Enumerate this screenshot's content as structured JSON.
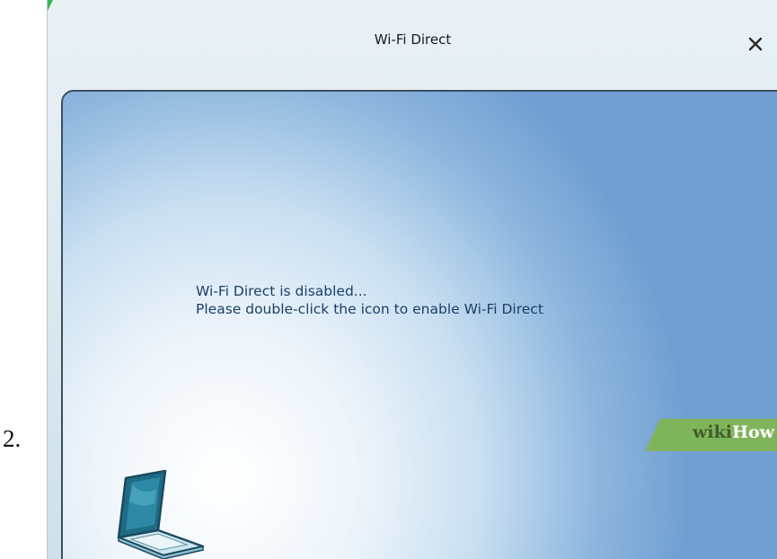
{
  "step": {
    "number": "2."
  },
  "window": {
    "title": "Wi-Fi Direct",
    "close_symbol": "×",
    "close_icon": "close-icon"
  },
  "message": {
    "line1": "Wi-Fi Direct is disabled...",
    "line2": "Please double-click the icon to enable Wi-Fi Direct"
  },
  "device_icon": "laptop-icon",
  "watermark": {
    "part1": "wiki",
    "part2": "How"
  },
  "colors": {
    "panel_blue": "#6f9fd2",
    "text_blue": "#1d3f66",
    "title_text": "#1a1a1a",
    "watermark_green": "#7fb45c"
  }
}
